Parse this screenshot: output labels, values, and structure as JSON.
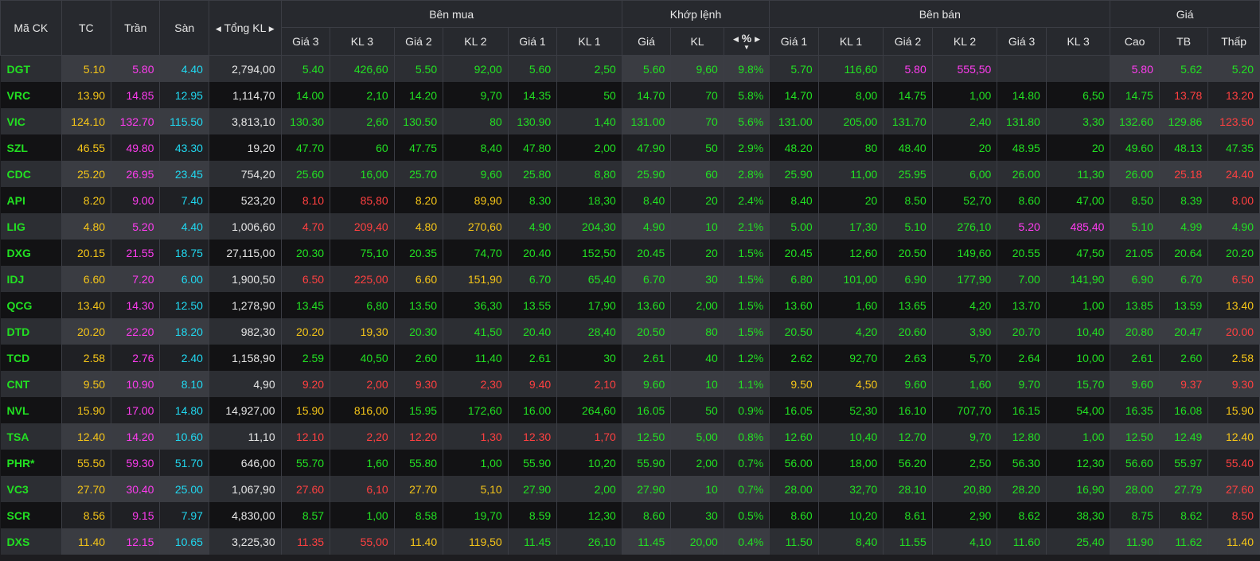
{
  "header": {
    "symbol": "Mã CK",
    "ref": "TC",
    "ceil": "Trần",
    "floor": "Sàn",
    "total_vol": "Tổng KL",
    "buy_group": "Bên mua",
    "match_group": "Khớp lệnh",
    "sell_group": "Bên bán",
    "price_group": "Giá",
    "buy_cols": [
      "Giá 3",
      "KL 3",
      "Giá 2",
      "KL 2",
      "Giá 1",
      "KL 1"
    ],
    "match_cols": [
      "Giá",
      "KL",
      "%"
    ],
    "sell_cols": [
      "Giá 1",
      "KL 1",
      "Giá 2",
      "KL 2",
      "Giá 3",
      "KL 3"
    ],
    "price_cols": [
      "Cao",
      "TB",
      "Thấp"
    ]
  },
  "colors": {
    "up": "#22e022",
    "ref": "#f5c518",
    "ceil": "#ff3cf0",
    "floor": "#20d8f0",
    "down": "#ff4040",
    "neutral": "#e6e6e6",
    "header_bg": "#27292e",
    "row_odd": "#2c2e33",
    "row_even": "#121214"
  },
  "rows": [
    {
      "sym": "DGT",
      "tc": "5.10",
      "ceil": "5.80",
      "floor": "4.40",
      "vol": "2,794,00",
      "b3p": "5.40",
      "b3v": "426,60",
      "b2p": "5.50",
      "b2v": "92,00",
      "b1p": "5.60",
      "b1v": "2,50",
      "mp": "5.60",
      "mv": "9,60",
      "pct": "9.8%",
      "s1p": "5.70",
      "s1v": "116,60",
      "s2p": "5.80",
      "s2v": "555,50",
      "s3p": "",
      "s3v": "",
      "hi": "5.80",
      "avg": "5.62",
      "lo": "5.20"
    },
    {
      "sym": "VRC",
      "tc": "13.90",
      "ceil": "14.85",
      "floor": "12.95",
      "vol": "1,114,70",
      "b3p": "14.00",
      "b3v": "2,10",
      "b2p": "14.20",
      "b2v": "9,70",
      "b1p": "14.35",
      "b1v": "50",
      "mp": "14.70",
      "mv": "70",
      "pct": "5.8%",
      "s1p": "14.70",
      "s1v": "8,00",
      "s2p": "14.75",
      "s2v": "1,00",
      "s3p": "14.80",
      "s3v": "6,50",
      "hi": "14.75",
      "avg": "13.78",
      "lo": "13.20"
    },
    {
      "sym": "VIC",
      "tc": "124.10",
      "ceil": "132.70",
      "floor": "115.50",
      "vol": "3,813,10",
      "b3p": "130.30",
      "b3v": "2,60",
      "b2p": "130.50",
      "b2v": "80",
      "b1p": "130.90",
      "b1v": "1,40",
      "mp": "131.00",
      "mv": "70",
      "pct": "5.6%",
      "s1p": "131.00",
      "s1v": "205,00",
      "s2p": "131.70",
      "s2v": "2,40",
      "s3p": "131.80",
      "s3v": "3,30",
      "hi": "132.60",
      "avg": "129.86",
      "lo": "123.50"
    },
    {
      "sym": "SZL",
      "tc": "46.55",
      "ceil": "49.80",
      "floor": "43.30",
      "vol": "19,20",
      "b3p": "47.70",
      "b3v": "60",
      "b2p": "47.75",
      "b2v": "8,40",
      "b1p": "47.80",
      "b1v": "2,00",
      "mp": "47.90",
      "mv": "50",
      "pct": "2.9%",
      "s1p": "48.20",
      "s1v": "80",
      "s2p": "48.40",
      "s2v": "20",
      "s3p": "48.95",
      "s3v": "20",
      "hi": "49.60",
      "avg": "48.13",
      "lo": "47.35"
    },
    {
      "sym": "CDC",
      "tc": "25.20",
      "ceil": "26.95",
      "floor": "23.45",
      "vol": "754,20",
      "b3p": "25.60",
      "b3v": "16,00",
      "b2p": "25.70",
      "b2v": "9,60",
      "b1p": "25.80",
      "b1v": "8,80",
      "mp": "25.90",
      "mv": "60",
      "pct": "2.8%",
      "s1p": "25.90",
      "s1v": "11,00",
      "s2p": "25.95",
      "s2v": "6,00",
      "s3p": "26.00",
      "s3v": "11,30",
      "hi": "26.00",
      "avg": "25.18",
      "lo": "24.40"
    },
    {
      "sym": "API",
      "tc": "8.20",
      "ceil": "9.00",
      "floor": "7.40",
      "vol": "523,20",
      "b3p": "8.10",
      "b3v": "85,80",
      "b2p": "8.20",
      "b2v": "89,90",
      "b1p": "8.30",
      "b1v": "18,30",
      "mp": "8.40",
      "mv": "20",
      "pct": "2.4%",
      "s1p": "8.40",
      "s1v": "20",
      "s2p": "8.50",
      "s2v": "52,70",
      "s3p": "8.60",
      "s3v": "47,00",
      "hi": "8.50",
      "avg": "8.39",
      "lo": "8.00"
    },
    {
      "sym": "LIG",
      "tc": "4.80",
      "ceil": "5.20",
      "floor": "4.40",
      "vol": "1,006,60",
      "b3p": "4.70",
      "b3v": "209,40",
      "b2p": "4.80",
      "b2v": "270,60",
      "b1p": "4.90",
      "b1v": "204,30",
      "mp": "4.90",
      "mv": "10",
      "pct": "2.1%",
      "s1p": "5.00",
      "s1v": "17,30",
      "s2p": "5.10",
      "s2v": "276,10",
      "s3p": "5.20",
      "s3v": "485,40",
      "hi": "5.10",
      "avg": "4.99",
      "lo": "4.90"
    },
    {
      "sym": "DXG",
      "tc": "20.15",
      "ceil": "21.55",
      "floor": "18.75",
      "vol": "27,115,00",
      "b3p": "20.30",
      "b3v": "75,10",
      "b2p": "20.35",
      "b2v": "74,70",
      "b1p": "20.40",
      "b1v": "152,50",
      "mp": "20.45",
      "mv": "20",
      "pct": "1.5%",
      "s1p": "20.45",
      "s1v": "12,60",
      "s2p": "20.50",
      "s2v": "149,60",
      "s3p": "20.55",
      "s3v": "47,50",
      "hi": "21.05",
      "avg": "20.64",
      "lo": "20.20"
    },
    {
      "sym": "IDJ",
      "tc": "6.60",
      "ceil": "7.20",
      "floor": "6.00",
      "vol": "1,900,50",
      "b3p": "6.50",
      "b3v": "225,00",
      "b2p": "6.60",
      "b2v": "151,90",
      "b1p": "6.70",
      "b1v": "65,40",
      "mp": "6.70",
      "mv": "30",
      "pct": "1.5%",
      "s1p": "6.80",
      "s1v": "101,00",
      "s2p": "6.90",
      "s2v": "177,90",
      "s3p": "7.00",
      "s3v": "141,90",
      "hi": "6.90",
      "avg": "6.70",
      "lo": "6.50"
    },
    {
      "sym": "QCG",
      "tc": "13.40",
      "ceil": "14.30",
      "floor": "12.50",
      "vol": "1,278,90",
      "b3p": "13.45",
      "b3v": "6,80",
      "b2p": "13.50",
      "b2v": "36,30",
      "b1p": "13.55",
      "b1v": "17,90",
      "mp": "13.60",
      "mv": "2,00",
      "pct": "1.5%",
      "s1p": "13.60",
      "s1v": "1,60",
      "s2p": "13.65",
      "s2v": "4,20",
      "s3p": "13.70",
      "s3v": "1,00",
      "hi": "13.85",
      "avg": "13.59",
      "lo": "13.40"
    },
    {
      "sym": "DTD",
      "tc": "20.20",
      "ceil": "22.20",
      "floor": "18.20",
      "vol": "982,30",
      "b3p": "20.20",
      "b3v": "19,30",
      "b2p": "20.30",
      "b2v": "41,50",
      "b1p": "20.40",
      "b1v": "28,40",
      "mp": "20.50",
      "mv": "80",
      "pct": "1.5%",
      "s1p": "20.50",
      "s1v": "4,20",
      "s2p": "20.60",
      "s2v": "3,90",
      "s3p": "20.70",
      "s3v": "10,40",
      "hi": "20.80",
      "avg": "20.47",
      "lo": "20.00"
    },
    {
      "sym": "TCD",
      "tc": "2.58",
      "ceil": "2.76",
      "floor": "2.40",
      "vol": "1,158,90",
      "b3p": "2.59",
      "b3v": "40,50",
      "b2p": "2.60",
      "b2v": "11,40",
      "b1p": "2.61",
      "b1v": "30",
      "mp": "2.61",
      "mv": "40",
      "pct": "1.2%",
      "s1p": "2.62",
      "s1v": "92,70",
      "s2p": "2.63",
      "s2v": "5,70",
      "s3p": "2.64",
      "s3v": "10,00",
      "hi": "2.61",
      "avg": "2.60",
      "lo": "2.58"
    },
    {
      "sym": "CNT",
      "tc": "9.50",
      "ceil": "10.90",
      "floor": "8.10",
      "vol": "4,90",
      "b3p": "9.20",
      "b3v": "2,00",
      "b2p": "9.30",
      "b2v": "2,30",
      "b1p": "9.40",
      "b1v": "2,10",
      "mp": "9.60",
      "mv": "10",
      "pct": "1.1%",
      "s1p": "9.50",
      "s1v": "4,50",
      "s2p": "9.60",
      "s2v": "1,60",
      "s3p": "9.70",
      "s3v": "15,70",
      "hi": "9.60",
      "avg": "9.37",
      "lo": "9.30"
    },
    {
      "sym": "NVL",
      "tc": "15.90",
      "ceil": "17.00",
      "floor": "14.80",
      "vol": "14,927,00",
      "b3p": "15.90",
      "b3v": "816,00",
      "b2p": "15.95",
      "b2v": "172,60",
      "b1p": "16.00",
      "b1v": "264,60",
      "mp": "16.05",
      "mv": "50",
      "pct": "0.9%",
      "s1p": "16.05",
      "s1v": "52,30",
      "s2p": "16.10",
      "s2v": "707,70",
      "s3p": "16.15",
      "s3v": "54,00",
      "hi": "16.35",
      "avg": "16.08",
      "lo": "15.90"
    },
    {
      "sym": "TSA",
      "tc": "12.40",
      "ceil": "14.20",
      "floor": "10.60",
      "vol": "11,10",
      "b3p": "12.10",
      "b3v": "2,20",
      "b2p": "12.20",
      "b2v": "1,30",
      "b1p": "12.30",
      "b1v": "1,70",
      "mp": "12.50",
      "mv": "5,00",
      "pct": "0.8%",
      "s1p": "12.60",
      "s1v": "10,40",
      "s2p": "12.70",
      "s2v": "9,70",
      "s3p": "12.80",
      "s3v": "1,00",
      "hi": "12.50",
      "avg": "12.49",
      "lo": "12.40"
    },
    {
      "sym": "PHR*",
      "tc": "55.50",
      "ceil": "59.30",
      "floor": "51.70",
      "vol": "646,00",
      "b3p": "55.70",
      "b3v": "1,60",
      "b2p": "55.80",
      "b2v": "1,00",
      "b1p": "55.90",
      "b1v": "10,20",
      "mp": "55.90",
      "mv": "2,00",
      "pct": "0.7%",
      "s1p": "56.00",
      "s1v": "18,00",
      "s2p": "56.20",
      "s2v": "2,50",
      "s3p": "56.30",
      "s3v": "12,30",
      "hi": "56.60",
      "avg": "55.97",
      "lo": "55.40"
    },
    {
      "sym": "VC3",
      "tc": "27.70",
      "ceil": "30.40",
      "floor": "25.00",
      "vol": "1,067,90",
      "b3p": "27.60",
      "b3v": "6,10",
      "b2p": "27.70",
      "b2v": "5,10",
      "b1p": "27.90",
      "b1v": "2,00",
      "mp": "27.90",
      "mv": "10",
      "pct": "0.7%",
      "s1p": "28.00",
      "s1v": "32,70",
      "s2p": "28.10",
      "s2v": "20,80",
      "s3p": "28.20",
      "s3v": "16,90",
      "hi": "28.00",
      "avg": "27.79",
      "lo": "27.60"
    },
    {
      "sym": "SCR",
      "tc": "8.56",
      "ceil": "9.15",
      "floor": "7.97",
      "vol": "4,830,00",
      "b3p": "8.57",
      "b3v": "1,00",
      "b2p": "8.58",
      "b2v": "19,70",
      "b1p": "8.59",
      "b1v": "12,30",
      "mp": "8.60",
      "mv": "30",
      "pct": "0.5%",
      "s1p": "8.60",
      "s1v": "10,20",
      "s2p": "8.61",
      "s2v": "2,90",
      "s3p": "8.62",
      "s3v": "38,30",
      "hi": "8.75",
      "avg": "8.62",
      "lo": "8.50"
    },
    {
      "sym": "DXS",
      "tc": "11.40",
      "ceil": "12.15",
      "floor": "10.65",
      "vol": "3,225,30",
      "b3p": "11.35",
      "b3v": "55,00",
      "b2p": "11.40",
      "b2v": "119,50",
      "b1p": "11.45",
      "b1v": "26,10",
      "mp": "11.45",
      "mv": "20,00",
      "pct": "0.4%",
      "s1p": "11.50",
      "s1v": "8,40",
      "s2p": "11.55",
      "s2v": "4,10",
      "s3p": "11.60",
      "s3v": "25,40",
      "hi": "11.90",
      "avg": "11.62",
      "lo": "11.40"
    }
  ]
}
